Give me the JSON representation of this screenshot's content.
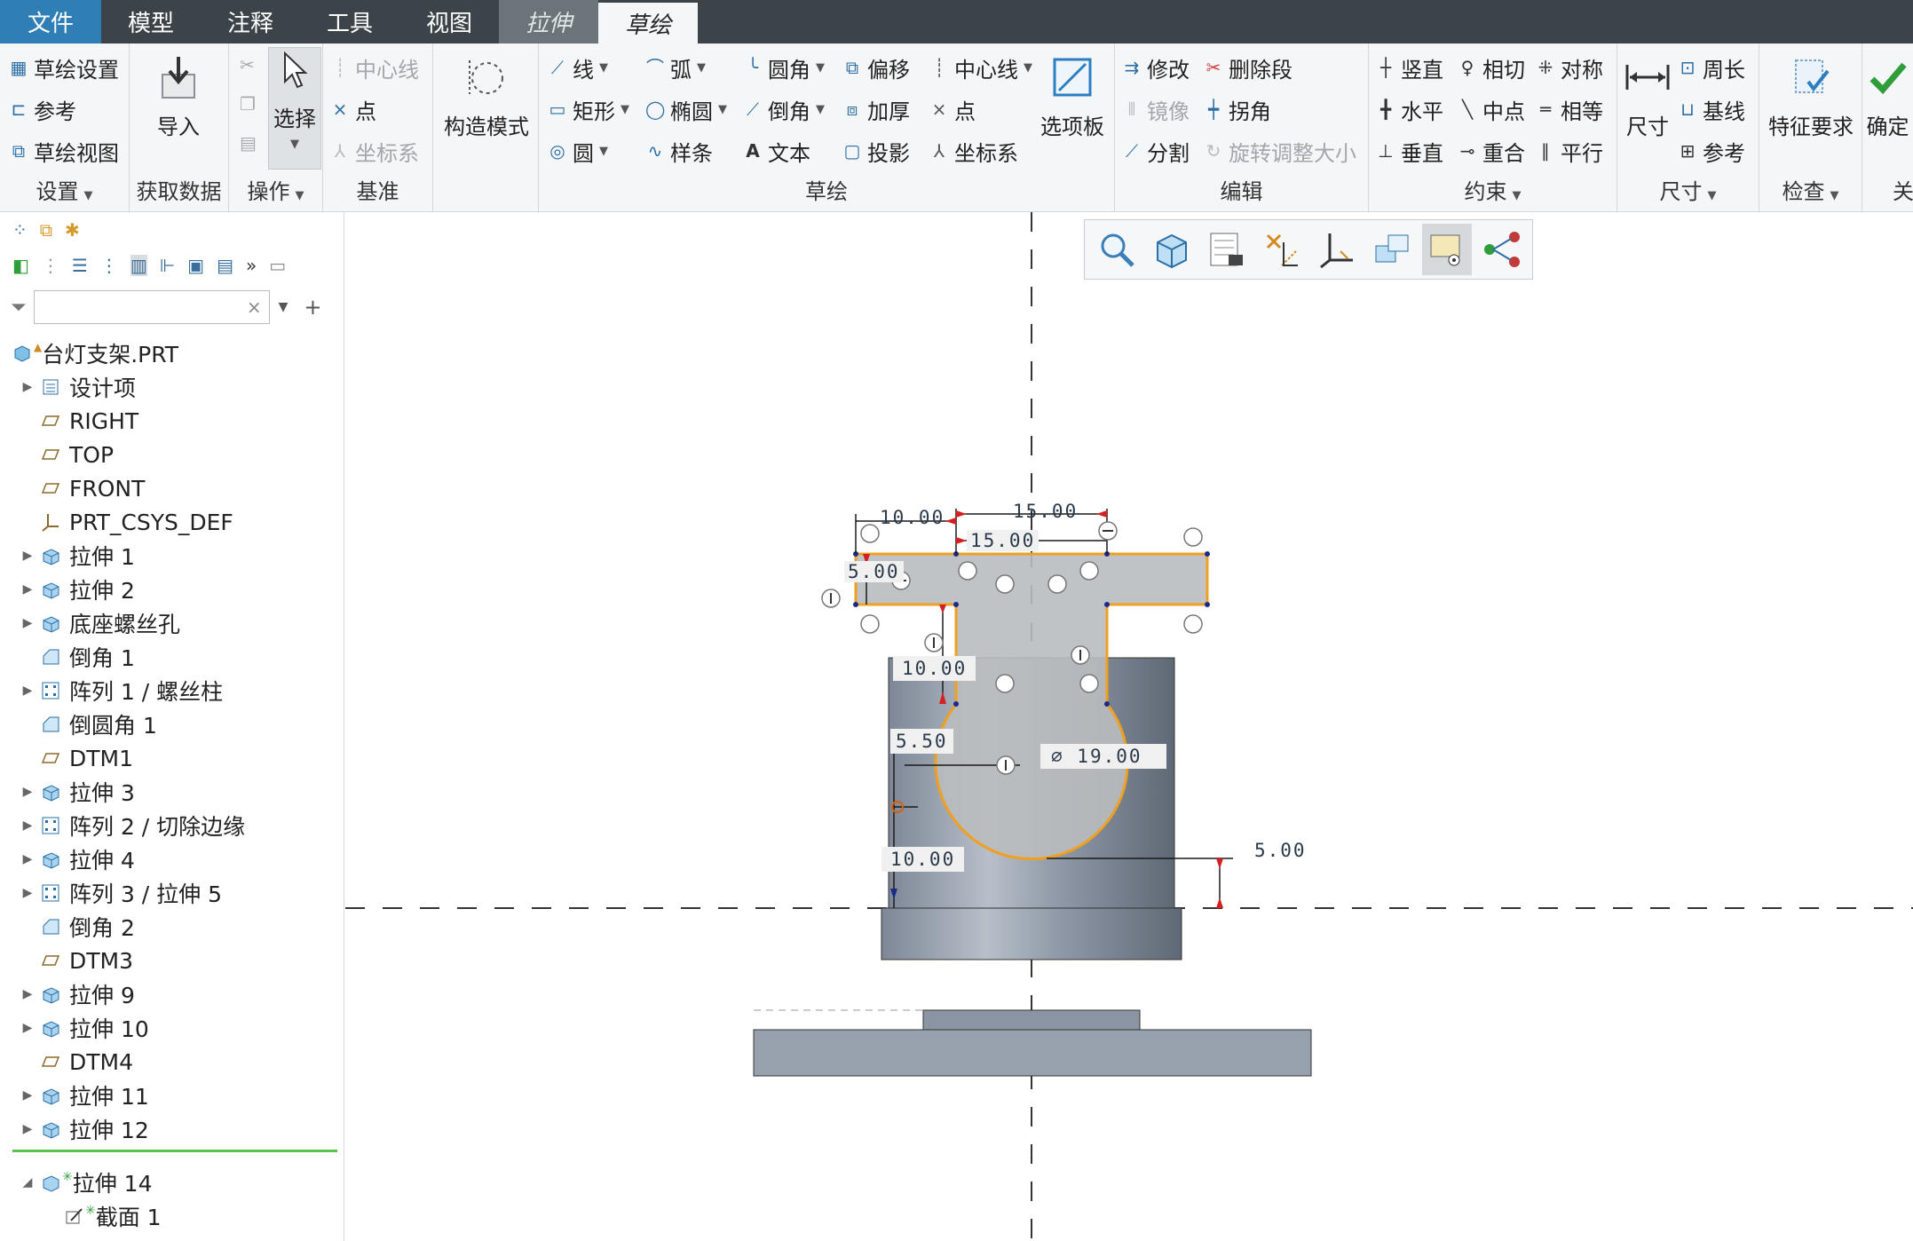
{
  "menu": {
    "tabs": [
      "文件",
      "模型",
      "注释",
      "工具",
      "视图",
      "拉伸",
      "草绘"
    ]
  },
  "ribbon": {
    "setup": {
      "items": [
        "草绘设置",
        "参考",
        "草绘视图"
      ],
      "label": "设置"
    },
    "get_data": {
      "import": "导入",
      "label": "获取数据"
    },
    "operations": {
      "select": "选择",
      "label": "操作"
    },
    "datum": {
      "items": [
        "中心线",
        "点",
        "坐标系"
      ],
      "label": "基准"
    },
    "construction_mode": "构造模式",
    "sketch": {
      "col1": [
        "线",
        "矩形",
        "圆"
      ],
      "col2": [
        "弧",
        "椭圆",
        "样条"
      ],
      "col3": [
        "圆角",
        "倒角",
        "文本"
      ],
      "col4": [
        "偏移",
        "加厚",
        "投影"
      ],
      "col5": [
        "中心线",
        "点",
        "坐标系"
      ],
      "label": "草绘"
    },
    "palette": "选项板",
    "edit": {
      "items": [
        "修改",
        "删除段",
        "镜像",
        "拐角",
        "分割",
        "旋转调整大小"
      ],
      "label": "编辑"
    },
    "constraints": {
      "items": [
        "竖直",
        "相切",
        "对称",
        "水平",
        "中点",
        "相等",
        "垂直",
        "重合",
        "平行"
      ],
      "label": "约束"
    },
    "dimension": {
      "dim": "尺寸",
      "items": [
        "周长",
        "基线",
        "参考"
      ],
      "label": "尺寸"
    },
    "inspect": {
      "feature_req": "特征要求",
      "label": "检查"
    },
    "close": {
      "ok": "确定",
      "label": "关"
    }
  },
  "tree": {
    "root": "台灯支架.PRT",
    "items": [
      {
        "label": "设计项",
        "icon": "design-items-icon",
        "expand": true
      },
      {
        "label": "RIGHT",
        "icon": "datum-plane-icon",
        "expand": false
      },
      {
        "label": "TOP",
        "icon": "datum-plane-icon",
        "expand": false
      },
      {
        "label": "FRONT",
        "icon": "datum-plane-icon",
        "expand": false
      },
      {
        "label": "PRT_CSYS_DEF",
        "icon": "csys-icon",
        "expand": false
      },
      {
        "label": "拉伸 1",
        "icon": "extrude-icon",
        "expand": true
      },
      {
        "label": "拉伸 2",
        "icon": "extrude-icon",
        "expand": true
      },
      {
        "label": "底座螺丝孔",
        "icon": "extrude-icon",
        "expand": true
      },
      {
        "label": "倒角 1",
        "icon": "chamfer-icon",
        "expand": false
      },
      {
        "label": "阵列 1 / 螺丝柱",
        "icon": "pattern-icon",
        "expand": true
      },
      {
        "label": "倒圆角 1",
        "icon": "chamfer-icon",
        "expand": false
      },
      {
        "label": "DTM1",
        "icon": "datum-plane-icon",
        "expand": false
      },
      {
        "label": "拉伸 3",
        "icon": "extrude-icon",
        "expand": true
      },
      {
        "label": "阵列 2 / 切除边缘",
        "icon": "pattern-icon",
        "expand": true
      },
      {
        "label": "拉伸 4",
        "icon": "extrude-icon",
        "expand": true
      },
      {
        "label": "阵列 3 / 拉伸 5",
        "icon": "pattern-icon",
        "expand": true
      },
      {
        "label": "倒角 2",
        "icon": "chamfer-icon",
        "expand": false
      },
      {
        "label": "DTM3",
        "icon": "datum-plane-icon",
        "expand": false
      },
      {
        "label": "拉伸 9",
        "icon": "extrude-icon",
        "expand": true
      },
      {
        "label": "拉伸 10",
        "icon": "extrude-icon",
        "expand": true
      },
      {
        "label": "DTM4",
        "icon": "datum-plane-icon",
        "expand": false
      },
      {
        "label": "拉伸 11",
        "icon": "extrude-icon",
        "expand": true
      },
      {
        "label": "拉伸 12",
        "icon": "extrude-icon",
        "expand": true
      }
    ],
    "active": {
      "label": "拉伸 14",
      "child": "截面 1"
    }
  },
  "sketch_dims": {
    "d1": "10.00",
    "d2": "15.00",
    "d3": "15.00",
    "d4": "5.00",
    "d5": "10.00",
    "d6": "5.50",
    "d7": "19.00",
    "d8": "10.00",
    "d9": "5.00"
  },
  "colors": {
    "menubar": "#3c4449",
    "file_tab": "#2f7fb6",
    "sketch_line": "#f0a020",
    "part_fill": "#8c96a2",
    "dim_arrow": "#d42020",
    "tree_separator": "#5cc24e"
  }
}
